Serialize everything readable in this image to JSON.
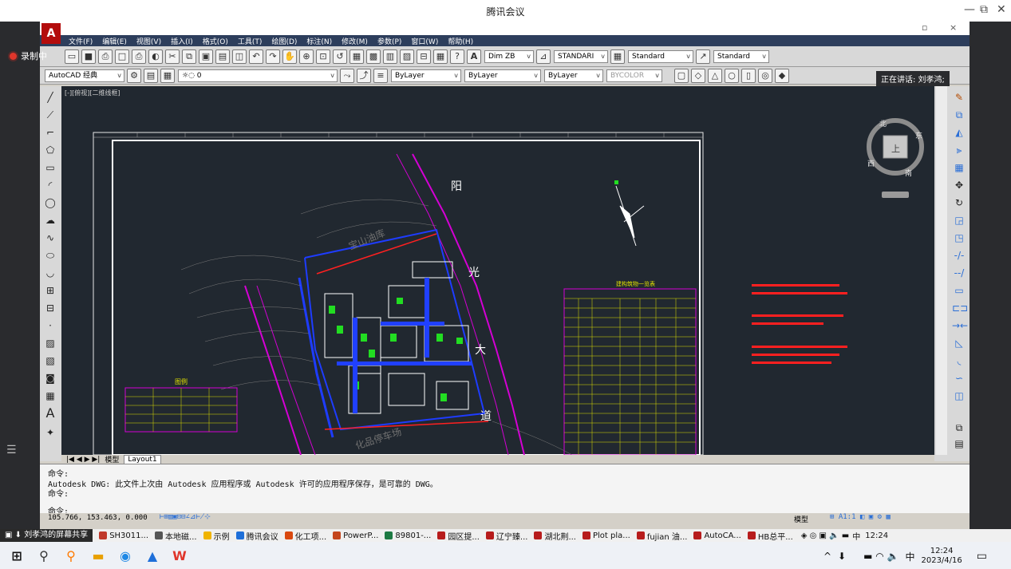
{
  "meeting": {
    "title": "腾讯会议",
    "minimize": "—",
    "restore": "⧉",
    "close": "✕"
  },
  "recording": {
    "label": "录制中"
  },
  "speaking": {
    "label": "正在讲话: 刘孝鸿;"
  },
  "cad": {
    "window_close": "×",
    "window_restore": "▫",
    "logo": "A",
    "menu": [
      "文件(F)",
      "编辑(E)",
      "视图(V)",
      "插入(I)",
      "格式(O)",
      "工具(T)",
      "绘图(D)",
      "标注(N)",
      "修改(M)",
      "参数(P)",
      "窗口(W)",
      "帮助(H)"
    ],
    "toolbar1": {
      "dim_style": "Dim ZB",
      "text_style": "STANDARI",
      "table_style": "Standard",
      "ml_style": "Standard"
    },
    "toolbar2": {
      "workspace": "AutoCAD 经典",
      "layer": "0",
      "color": "ByLayer",
      "linetype": "ByLayer",
      "lineweight": "ByLayer",
      "plotstyle": "BYCOLOR"
    },
    "view_label": "[-][俯视][二维线框]",
    "tabs": [
      "模型",
      "Layout1"
    ],
    "command": {
      "line1": "命令:",
      "line2": "Autodesk DWG:   此文件上次由 Autodesk 应用程序或 Autodesk 许可的应用程序保存，是可靠的 DWG。",
      "line3": "命令:",
      "prompt": "命令:"
    },
    "status": {
      "coords": "105.766, 153.463, 0.000",
      "model": "模型"
    },
    "drawing_text": {
      "road_1": "阳",
      "road_2": "光",
      "road_3": "大",
      "road_4": "道",
      "area_1": "宝山油库",
      "area_2": "化品停车场",
      "table_title": "建构筑物一览表",
      "legend_title": "图例",
      "compass_up": "北",
      "compass_down": "南",
      "compass_left": "西",
      "compass_right": "东",
      "compass_center": "上"
    }
  },
  "share_bar": {
    "label": "刘孝鸿的屏幕共享",
    "tasks": [
      {
        "label": "SH3011...",
        "color": "#c0392b"
      },
      {
        "label": "本地磁...",
        "color": "#555555"
      },
      {
        "label": "示例",
        "color": "#f0b400"
      },
      {
        "label": "腾讯会议",
        "color": "#1e6fd9"
      },
      {
        "label": "化工项...",
        "color": "#d9480f"
      },
      {
        "label": "PowerP...",
        "color": "#c4451c"
      },
      {
        "label": "89801-...",
        "color": "#1d7a43"
      },
      {
        "label": "园区提...",
        "color": "#b71c1c"
      },
      {
        "label": "辽宁臻...",
        "color": "#b71c1c"
      },
      {
        "label": "湖北荆...",
        "color": "#b71c1c"
      },
      {
        "label": "Plot pla...",
        "color": "#b71c1c"
      },
      {
        "label": "fujian 油...",
        "color": "#b71c1c"
      },
      {
        "label": "AutoCA...",
        "color": "#b71c1c"
      },
      {
        "label": "HB总平...",
        "color": "#b71c1c"
      }
    ],
    "tray_time": "12:24",
    "tray_ime": "中"
  },
  "taskbar": {
    "time": "12:24",
    "date": "2023/4/16",
    "ime": "中"
  }
}
